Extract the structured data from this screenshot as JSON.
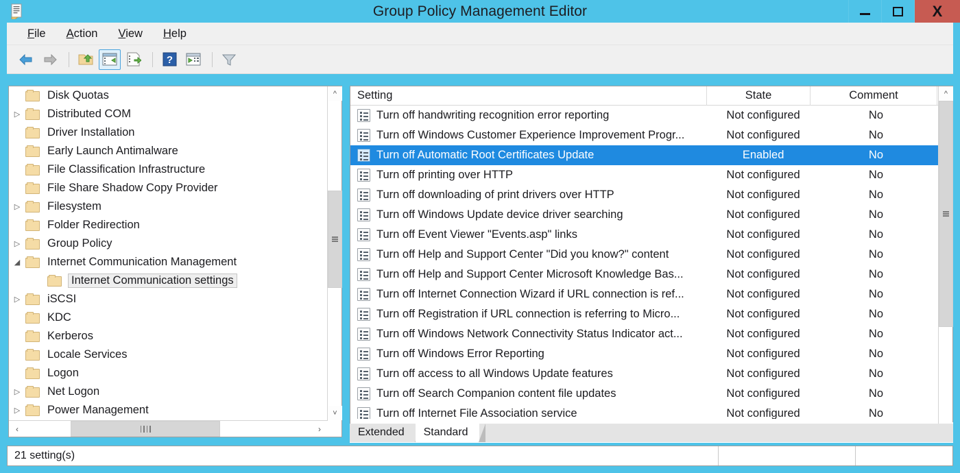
{
  "window": {
    "title": "Group Policy Management Editor",
    "app_icon": "document-icon",
    "controls": {
      "minimize": "minimize-icon",
      "maximize": "maximize-icon",
      "close": "X"
    },
    "colors": {
      "titlebar": "#4ec3e8",
      "close_button": "#c75b52",
      "selection": "#1f8ae0",
      "chrome": "#f0f0f0"
    }
  },
  "menubar": {
    "items": [
      {
        "label": "File",
        "accel": "F"
      },
      {
        "label": "Action",
        "accel": "A"
      },
      {
        "label": "View",
        "accel": "V"
      },
      {
        "label": "Help",
        "accel": "H"
      }
    ]
  },
  "toolbar": {
    "buttons": [
      {
        "name": "back-icon",
        "tooltip": "Back"
      },
      {
        "name": "forward-icon",
        "tooltip": "Forward"
      },
      {
        "name": "up-folder-icon",
        "tooltip": "Up One Level"
      },
      {
        "name": "show-hide-tree-icon",
        "tooltip": "Show/Hide Console Tree",
        "active": true
      },
      {
        "name": "export-list-icon",
        "tooltip": "Export List"
      },
      {
        "name": "help-icon",
        "tooltip": "Help"
      },
      {
        "name": "properties-icon",
        "tooltip": "Properties"
      },
      {
        "name": "filter-icon",
        "tooltip": "Filter Options"
      }
    ]
  },
  "tree": {
    "items": [
      {
        "label": "Disk Quotas",
        "expandable": false,
        "indent": 1,
        "selected": false
      },
      {
        "label": "Distributed COM",
        "expandable": true,
        "indent": 1,
        "selected": false
      },
      {
        "label": "Driver Installation",
        "expandable": false,
        "indent": 1,
        "selected": false
      },
      {
        "label": "Early Launch Antimalware",
        "expandable": false,
        "indent": 1,
        "selected": false
      },
      {
        "label": "File Classification Infrastructure",
        "expandable": false,
        "indent": 1,
        "selected": false
      },
      {
        "label": "File Share Shadow Copy Provider",
        "expandable": false,
        "indent": 1,
        "selected": false
      },
      {
        "label": "Filesystem",
        "expandable": true,
        "indent": 1,
        "selected": false
      },
      {
        "label": "Folder Redirection",
        "expandable": false,
        "indent": 1,
        "selected": false
      },
      {
        "label": "Group Policy",
        "expandable": true,
        "indent": 1,
        "selected": false
      },
      {
        "label": "Internet Communication Management",
        "expandable": true,
        "expanded": true,
        "indent": 1,
        "selected": false
      },
      {
        "label": "Internet Communication settings",
        "expandable": false,
        "indent": 2,
        "selected": true
      },
      {
        "label": "iSCSI",
        "expandable": true,
        "indent": 1,
        "selected": false
      },
      {
        "label": "KDC",
        "expandable": false,
        "indent": 1,
        "selected": false
      },
      {
        "label": "Kerberos",
        "expandable": false,
        "indent": 1,
        "selected": false
      },
      {
        "label": "Locale Services",
        "expandable": false,
        "indent": 1,
        "selected": false
      },
      {
        "label": "Logon",
        "expandable": false,
        "indent": 1,
        "selected": false
      },
      {
        "label": "Net Logon",
        "expandable": true,
        "indent": 1,
        "selected": false
      },
      {
        "label": "Power Management",
        "expandable": true,
        "indent": 1,
        "selected": false
      }
    ]
  },
  "list": {
    "columns": [
      "Setting",
      "State",
      "Comment"
    ],
    "rows": [
      {
        "setting": "Turn off handwriting recognition error reporting",
        "state": "Not configured",
        "comment": "No",
        "selected": false
      },
      {
        "setting": "Turn off Windows Customer Experience Improvement Progr...",
        "state": "Not configured",
        "comment": "No",
        "selected": false
      },
      {
        "setting": "Turn off Automatic Root Certificates Update",
        "state": "Enabled",
        "comment": "No",
        "selected": true
      },
      {
        "setting": "Turn off printing over HTTP",
        "state": "Not configured",
        "comment": "No",
        "selected": false
      },
      {
        "setting": "Turn off downloading of print drivers over HTTP",
        "state": "Not configured",
        "comment": "No",
        "selected": false
      },
      {
        "setting": "Turn off Windows Update device driver searching",
        "state": "Not configured",
        "comment": "No",
        "selected": false
      },
      {
        "setting": "Turn off Event Viewer \"Events.asp\" links",
        "state": "Not configured",
        "comment": "No",
        "selected": false
      },
      {
        "setting": "Turn off Help and Support Center \"Did you know?\" content",
        "state": "Not configured",
        "comment": "No",
        "selected": false
      },
      {
        "setting": "Turn off Help and Support Center Microsoft Knowledge Bas...",
        "state": "Not configured",
        "comment": "No",
        "selected": false
      },
      {
        "setting": "Turn off Internet Connection Wizard if URL connection is ref...",
        "state": "Not configured",
        "comment": "No",
        "selected": false
      },
      {
        "setting": "Turn off Registration if URL connection is referring to Micro...",
        "state": "Not configured",
        "comment": "No",
        "selected": false
      },
      {
        "setting": "Turn off Windows Network Connectivity Status Indicator act...",
        "state": "Not configured",
        "comment": "No",
        "selected": false
      },
      {
        "setting": "Turn off Windows Error Reporting",
        "state": "Not configured",
        "comment": "No",
        "selected": false
      },
      {
        "setting": "Turn off access to all Windows Update features",
        "state": "Not configured",
        "comment": "No",
        "selected": false
      },
      {
        "setting": "Turn off Search Companion content file updates",
        "state": "Not configured",
        "comment": "No",
        "selected": false
      },
      {
        "setting": "Turn off Internet File Association service",
        "state": "Not configured",
        "comment": "No",
        "selected": false
      }
    ]
  },
  "tabs": [
    {
      "label": "Extended",
      "active": false
    },
    {
      "label": "Standard",
      "active": true
    }
  ],
  "statusbar": {
    "text": "21 setting(s)"
  }
}
